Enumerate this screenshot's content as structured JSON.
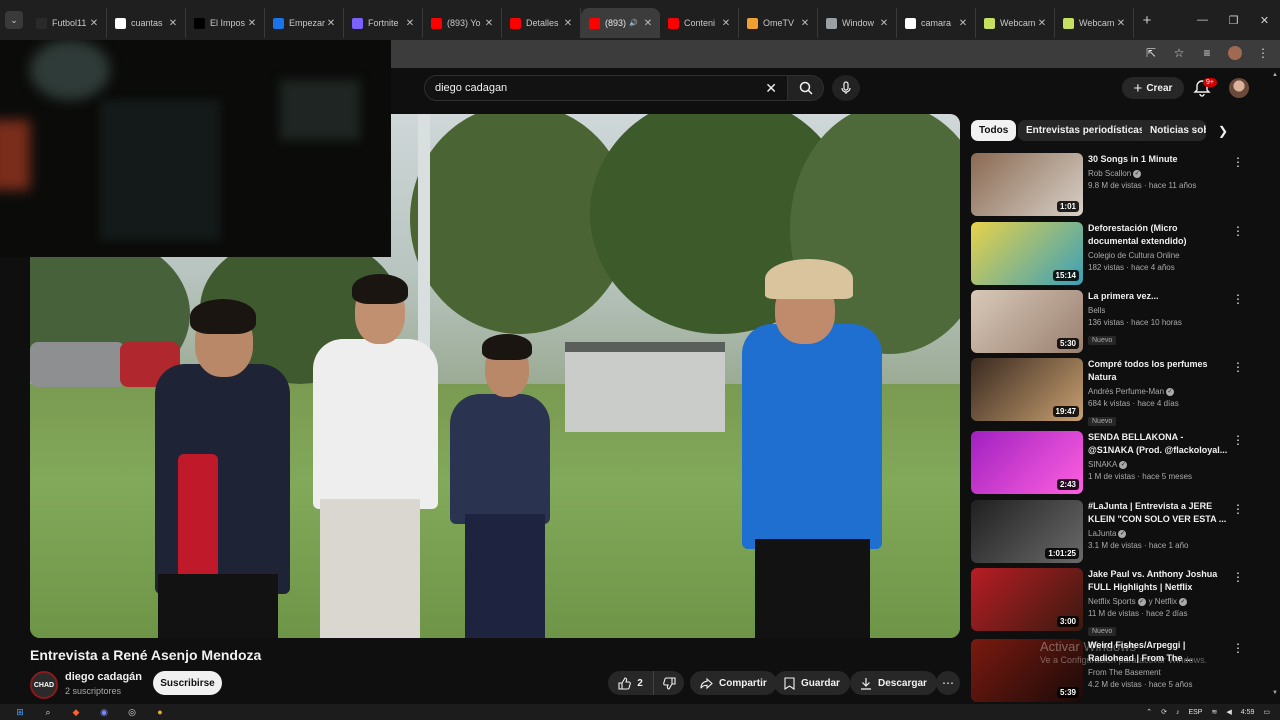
{
  "browser": {
    "tabs": [
      {
        "label": "Futbol11",
        "icon": "futbol-icon",
        "color": "#2a2a2a"
      },
      {
        "label": "cuantas",
        "icon": "google-icon",
        "color": "#ffffff"
      },
      {
        "label": "El Impos",
        "icon": "tiktok-icon",
        "color": "#000000"
      },
      {
        "label": "Empezar",
        "icon": "page-icon",
        "color": "#1a73e8"
      },
      {
        "label": "Fortnite",
        "icon": "epic-icon",
        "color": "#7b61ff"
      },
      {
        "label": "(893) Yo",
        "icon": "youtube-icon",
        "color": "#ff0000"
      },
      {
        "label": "Detalles",
        "icon": "youtube-studio-icon",
        "color": "#ff0000"
      },
      {
        "label": "(893)",
        "icon": "youtube-icon",
        "color": "#ff0000",
        "active": true
      },
      {
        "label": "Conteni",
        "icon": "youtube-studio-icon",
        "color": "#ff0000"
      },
      {
        "label": "OmeTV",
        "icon": "ometv-icon",
        "color": "#f0a030"
      },
      {
        "label": "Window",
        "icon": "globe-icon",
        "color": "#9aa0a6"
      },
      {
        "label": "camara",
        "icon": "google-icon",
        "color": "#ffffff"
      },
      {
        "label": "Webcam",
        "icon": "webcam-icon",
        "color": "#c8e060"
      },
      {
        "label": "Webcam",
        "icon": "webcam-icon",
        "color": "#c8e060"
      }
    ]
  },
  "youtube": {
    "search_query": "diego cadagan",
    "create_label": "Crear",
    "notifications_badge": "9+",
    "video_title": "Entrevista a René Asenjo Mendoza",
    "channel": {
      "name": "diego cadagán",
      "subscribers": "2 suscriptores",
      "avatar_text": "CHAD"
    },
    "subscribe_label": "Suscribirse",
    "likes": "2",
    "share_label": "Compartir",
    "save_label": "Guardar",
    "download_label": "Descargar",
    "chips": [
      "Todos",
      "Entrevistas periodísticas",
      "Noticias sob"
    ],
    "recommendations": [
      {
        "title": "30 Songs in 1 Minute",
        "channel": "Rob Scallon",
        "verified": true,
        "meta": "9.8 M de vistas · hace 11 años",
        "duration": "1:01",
        "badge": "",
        "color1": "#8a6a52",
        "color2": "#d8d0c8"
      },
      {
        "title": "Deforestación (Micro documental extendido)",
        "channel": "Colegio de Cultura Online",
        "verified": false,
        "meta": "182 vistas · hace 4 años",
        "duration": "15:14",
        "badge": "",
        "color1": "#e8d24a",
        "color2": "#3aa0b8"
      },
      {
        "title": "La primera vez...",
        "channel": "Bells",
        "verified": false,
        "meta": "136 vistas · hace 10 horas",
        "duration": "5:30",
        "badge": "Nuevo",
        "color1": "#d8c8b8",
        "color2": "#9a8070"
      },
      {
        "title": "Compré todos los perfumes Natura",
        "channel": "Andrés Perfume-Man",
        "verified": true,
        "meta": "684 k vistas · hace 4 días",
        "duration": "19:47",
        "badge": "Nuevo",
        "color1": "#3a2a20",
        "color2": "#c8a070"
      },
      {
        "title": "SENDA BELLAKONA - @S1NAKA (Prod. @flackoloyal...",
        "channel": "SINAKA",
        "verified": true,
        "meta": "1 M de vistas · hace 5 meses",
        "duration": "2:43",
        "badge": "",
        "color1": "#a020c0",
        "color2": "#ff60e0"
      },
      {
        "title": "#LaJunta | Entrevista a JERE KLEIN \"CON SOLO VER ESTA ...",
        "channel": "LaJunta",
        "verified": true,
        "meta": "3.1 M de vistas · hace 1 año",
        "duration": "1:01:25",
        "badge": "",
        "color1": "#202020",
        "color2": "#6a6a6a"
      },
      {
        "title": "Jake Paul vs. Anthony Joshua FULL Highlights | Netflix",
        "channel": "Netflix Sports",
        "verified": true,
        "meta": "11 M de vistas · hace 2 días",
        "duration": "3:00",
        "badge": "Nuevo",
        "color1": "#b81d24",
        "color2": "#3a1a10",
        "channel_extra": "y Netflix"
      },
      {
        "title": "Weird Fishes/Arpeggi | Radiohead | From The ...",
        "channel": "From The Basement",
        "verified": false,
        "meta": "4.2 M de vistas · hace 5 años",
        "duration": "5:39",
        "badge": "",
        "color1": "#7a1a10",
        "color2": "#1a0a08"
      }
    ],
    "watermark_line1": "Activar Windows",
    "watermark_line2": "Ve a Configuración para activar Windows."
  },
  "taskbar": {
    "language": "ESP",
    "time": "4:59"
  }
}
